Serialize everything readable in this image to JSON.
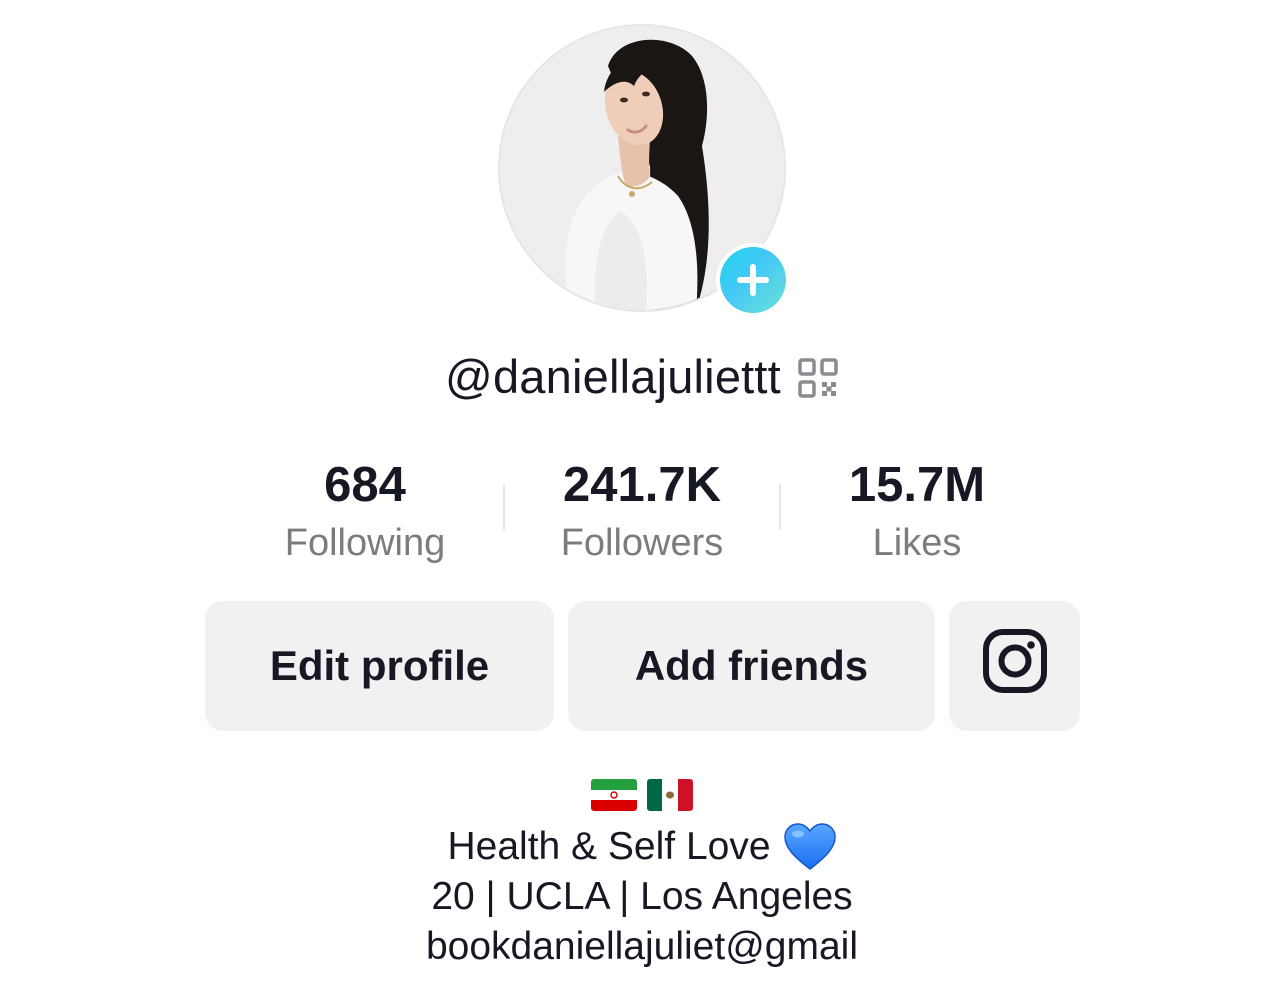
{
  "profile": {
    "username": "@daniellajuliettt",
    "avatar_alt": "profile photo",
    "add_icon": "plus-icon",
    "qr_icon": "qr-code-icon"
  },
  "stats": {
    "following": {
      "value": "684",
      "label": "Following"
    },
    "followers": {
      "value": "241.7K",
      "label": "Followers"
    },
    "likes": {
      "value": "15.7M",
      "label": "Likes"
    }
  },
  "actions": {
    "edit_profile": "Edit profile",
    "add_friends": "Add friends",
    "instagram_icon": "instagram-icon"
  },
  "bio": {
    "flags": [
      "iran-flag",
      "mexico-flag"
    ],
    "line1": "Health & Self Love",
    "line1_emoji": "blue-heart-icon",
    "line2": "20 | UCLA | Los Angeles",
    "line3": "bookdaniellajuliet@gmail"
  },
  "colors": {
    "text": "#161823",
    "muted": "#7b7c80",
    "button_bg": "#f1f1f2",
    "badge_start": "#20d5ec",
    "badge_end": "#6ce3d8"
  }
}
